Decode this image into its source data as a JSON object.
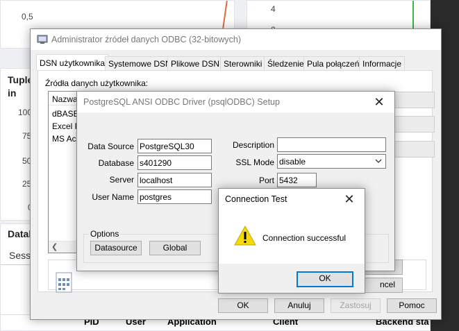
{
  "background": {
    "left_chart_tick": "0,5",
    "right_chart_tick_top": "4",
    "right_chart_tick_mid": "2",
    "tuples_title_line1": "Tuple",
    "tuples_title_line2": "in",
    "tuples_ticks": [
      "100",
      "75",
      "50",
      "25",
      "0"
    ],
    "database_section": "Datab",
    "sessions_tab": "Sess",
    "table_headers": [
      "PID",
      "User",
      "Application",
      "Client",
      "Backend sta"
    ]
  },
  "odbc_admin": {
    "title": "Administrator źródeł danych ODBC (32-bitowych)",
    "tabs": [
      "DSN użytkownika",
      "Systemowe DSN",
      "Plikowe DSN",
      "Sterowniki",
      "Śledzenie",
      "Pula połączeń",
      "Informacje"
    ],
    "sources_label": "Źródła danych użytkownika:",
    "list_header_name": "Nazwa",
    "list_items": [
      "dBASE",
      "Excel Fi",
      "MS Acc"
    ],
    "side_buttons_visible": [
      "est",
      "ncel"
    ],
    "ok_label": "OK",
    "cancel_label": "Anuluj",
    "apply_label": "Zastosuj",
    "help_label": "Pomoc"
  },
  "setup_dialog": {
    "title": "PostgreSQL ANSI ODBC Driver (psqlODBC) Setup",
    "fields": {
      "data_source_label": "Data Source",
      "data_source_value": "PostgreSQL30",
      "database_label": "Database",
      "database_value": "s401290",
      "server_label": "Server",
      "server_value": "localhost",
      "user_name_label": "User Name",
      "user_name_value": "postgres",
      "description_label": "Description",
      "description_value": "",
      "ssl_mode_label": "SSL Mode",
      "ssl_mode_value": "disable",
      "port_label": "Port",
      "port_value": "5432"
    },
    "options_label": "Options",
    "datasource_button": "Datasource",
    "global_button": "Global"
  },
  "connection_test": {
    "title": "Connection Test",
    "message": "Connection successful",
    "ok_label": "OK",
    "icon": "warning-icon"
  }
}
